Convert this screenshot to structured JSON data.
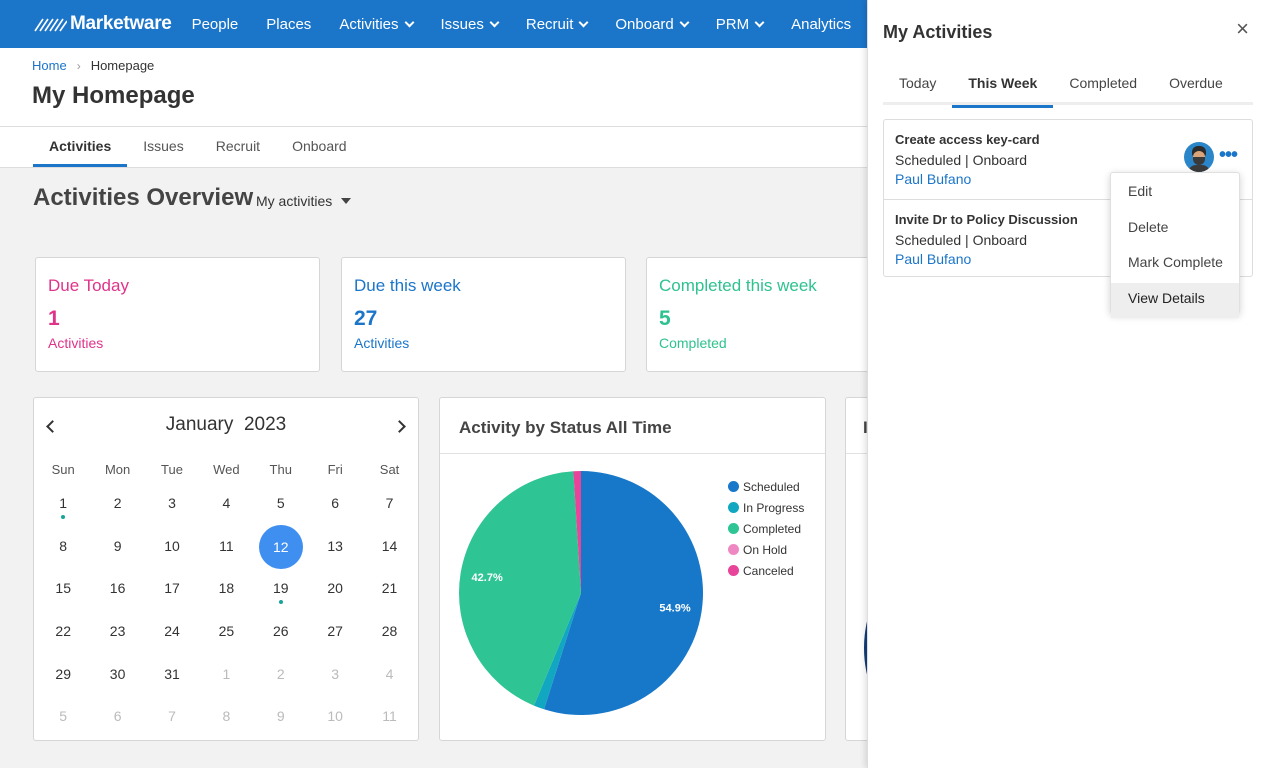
{
  "brand": {
    "name": "Marketware",
    "color": "#1b75c9"
  },
  "nav": {
    "items": [
      {
        "label": "People",
        "dropdown": false
      },
      {
        "label": "Places",
        "dropdown": false
      },
      {
        "label": "Activities",
        "dropdown": true
      },
      {
        "label": "Issues",
        "dropdown": true
      },
      {
        "label": "Recruit",
        "dropdown": true
      },
      {
        "label": "Onboard",
        "dropdown": true
      },
      {
        "label": "PRM",
        "dropdown": true
      },
      {
        "label": "Analytics",
        "dropdown": false
      }
    ]
  },
  "breadcrumb": {
    "home": "Home",
    "separator": "›",
    "current": "Homepage"
  },
  "page_title": "My Homepage",
  "subtabs": [
    {
      "label": "Activities",
      "active": true
    },
    {
      "label": "Issues",
      "active": false
    },
    {
      "label": "Recruit",
      "active": false
    },
    {
      "label": "Onboard",
      "active": false
    }
  ],
  "overview": {
    "title": "Activities Overview",
    "filter": "My activities",
    "cards": [
      {
        "label": "Due Today",
        "value": "1",
        "sub": "Activities",
        "color": "#e0338a"
      },
      {
        "label": "Due this week",
        "value": "27",
        "sub": "Activities",
        "color": "#1b75c9"
      },
      {
        "label": "Completed this week",
        "value": "5",
        "sub": "Completed",
        "color": "#2ec28e"
      }
    ]
  },
  "calendar": {
    "month": "January",
    "year": "2023",
    "weekdays": [
      "Sun",
      "Mon",
      "Tue",
      "Wed",
      "Thu",
      "Fri",
      "Sat"
    ],
    "weeks": [
      [
        {
          "d": "1",
          "dot": true
        },
        {
          "d": "2"
        },
        {
          "d": "3"
        },
        {
          "d": "4"
        },
        {
          "d": "5"
        },
        {
          "d": "6"
        },
        {
          "d": "7"
        }
      ],
      [
        {
          "d": "8"
        },
        {
          "d": "9"
        },
        {
          "d": "10"
        },
        {
          "d": "11"
        },
        {
          "d": "12",
          "today": true
        },
        {
          "d": "13"
        },
        {
          "d": "14"
        }
      ],
      [
        {
          "d": "15"
        },
        {
          "d": "16"
        },
        {
          "d": "17"
        },
        {
          "d": "18"
        },
        {
          "d": "19",
          "dot": true
        },
        {
          "d": "20"
        },
        {
          "d": "21"
        }
      ],
      [
        {
          "d": "22"
        },
        {
          "d": "23"
        },
        {
          "d": "24"
        },
        {
          "d": "25"
        },
        {
          "d": "26"
        },
        {
          "d": "27"
        },
        {
          "d": "28"
        }
      ],
      [
        {
          "d": "29"
        },
        {
          "d": "30"
        },
        {
          "d": "31"
        },
        {
          "d": "1",
          "muted": true
        },
        {
          "d": "2",
          "muted": true
        },
        {
          "d": "3",
          "muted": true
        },
        {
          "d": "4",
          "muted": true
        }
      ],
      [
        {
          "d": "5",
          "muted": true
        },
        {
          "d": "6",
          "muted": true
        },
        {
          "d": "7",
          "muted": true
        },
        {
          "d": "8",
          "muted": true
        },
        {
          "d": "9",
          "muted": true
        },
        {
          "d": "10",
          "muted": true
        },
        {
          "d": "11",
          "muted": true
        }
      ]
    ]
  },
  "pie_card": {
    "title": "Activity by Status All Time"
  },
  "chart_data": {
    "type": "pie",
    "title": "Activity by Status All Time",
    "series": [
      {
        "name": "Scheduled",
        "value": 54.9,
        "label": "54.9%",
        "color": "#1778c9"
      },
      {
        "name": "In Progress",
        "value": 1.4,
        "label": "",
        "color": "#11a7c1"
      },
      {
        "name": "Completed",
        "value": 42.7,
        "label": "42.7%",
        "color": "#2ec494"
      },
      {
        "name": "On Hold",
        "value": 0.0,
        "label": "",
        "color": "#ef88c2"
      },
      {
        "name": "Canceled",
        "value": 1.0,
        "label": "",
        "color": "#e8449a"
      }
    ],
    "legend_position": "right"
  },
  "third_card": {
    "title_fragment": "I"
  },
  "panel": {
    "title": "My Activities",
    "close": "×",
    "tabs": [
      {
        "label": "Today",
        "active": false
      },
      {
        "label": "This Week",
        "active": true
      },
      {
        "label": "Completed",
        "active": false
      },
      {
        "label": "Overdue",
        "active": false
      }
    ],
    "activities": [
      {
        "title": "Create access key-card",
        "meta": "Scheduled | Onboard",
        "person": "Paul Bufano"
      },
      {
        "title": "Invite Dr to Policy Discussion",
        "meta": "Scheduled | Onboard",
        "person": "Paul Bufano"
      }
    ],
    "more": "•••",
    "menu": [
      "Edit",
      "Delete",
      "Mark Complete",
      "View Details"
    ],
    "menu_hover": "View Details"
  }
}
